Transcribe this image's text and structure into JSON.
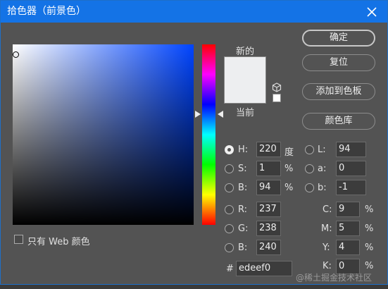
{
  "window": {
    "title": "拾色器（前景色）",
    "close_icon": "close-icon"
  },
  "picker": {
    "new_label": "新的",
    "current_label": "当前",
    "new_color": "#edeef0",
    "current_color": "#edeef0",
    "web_only_label": "只有 Web 颜色",
    "web_only_checked": false
  },
  "buttons": {
    "ok": "确定",
    "reset": "复位",
    "add_to_swatches": "添加到色板",
    "color_libraries": "颜色库"
  },
  "hsb": {
    "h": {
      "label": "H:",
      "value": "220",
      "unit": "度",
      "selected": true
    },
    "s": {
      "label": "S:",
      "value": "1",
      "unit": "%"
    },
    "b": {
      "label": "B:",
      "value": "94",
      "unit": "%"
    }
  },
  "lab": {
    "l": {
      "label": "L:",
      "value": "94"
    },
    "a": {
      "label": "a:",
      "value": "0"
    },
    "b": {
      "label": "b:",
      "value": "-1"
    }
  },
  "rgb": {
    "r": {
      "label": "R:",
      "value": "237"
    },
    "g": {
      "label": "G:",
      "value": "238"
    },
    "b": {
      "label": "B:",
      "value": "240"
    }
  },
  "cmyk": {
    "c": {
      "label": "C:",
      "value": "9",
      "unit": "%"
    },
    "m": {
      "label": "M:",
      "value": "5",
      "unit": "%"
    },
    "y": {
      "label": "Y:",
      "value": "4",
      "unit": "%"
    },
    "k": {
      "label": "K:",
      "value": "0",
      "unit": "%"
    }
  },
  "hex": {
    "label": "#",
    "value": "edeef0"
  },
  "watermark": "@稀土掘金技术社区"
}
